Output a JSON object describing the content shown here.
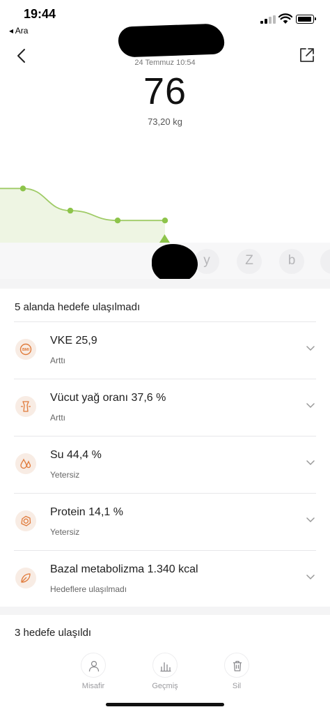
{
  "status_bar": {
    "time": "19:44",
    "back_app": "◂ Ara"
  },
  "header": {
    "date": "24 Temmuz 10:54",
    "value": "76",
    "weight": "73,20 kg"
  },
  "chart_data": {
    "type": "area",
    "values": [
      72.8,
      71.9,
      71.5,
      71.5
    ],
    "color": "#8dc44a",
    "grid": false
  },
  "date_strip": [
    "y",
    "Z",
    "b"
  ],
  "unmet": {
    "title": "5 alanda hedefe ulaşılmadı",
    "items": [
      {
        "icon": "bmi-icon",
        "title": "VKE 25,9",
        "status": "Arttı"
      },
      {
        "icon": "body-fat-icon",
        "title": "Vücut yağ oranı 37,6 %",
        "status": "Arttı"
      },
      {
        "icon": "water-drops-icon",
        "title": "Su 44,4 %",
        "status": "Yetersiz"
      },
      {
        "icon": "protein-icon",
        "title": "Protein 14,1 %",
        "status": "Yetersiz"
      },
      {
        "icon": "leaf-icon",
        "title": "Bazal metabolizma 1.340 kcal",
        "status": "Hedeflere ulaşılmadı"
      }
    ]
  },
  "met": {
    "title": "3 hedefe ulaşıldı"
  },
  "tabs": [
    {
      "icon": "person-icon",
      "label": "Misafir"
    },
    {
      "icon": "bar-chart-icon",
      "label": "Geçmiş"
    },
    {
      "icon": "trash-icon",
      "label": "Sil"
    }
  ],
  "colors": {
    "accent": "#8dc44a",
    "icon": "#e07a3a",
    "icon_bg": "#f8ece4"
  }
}
